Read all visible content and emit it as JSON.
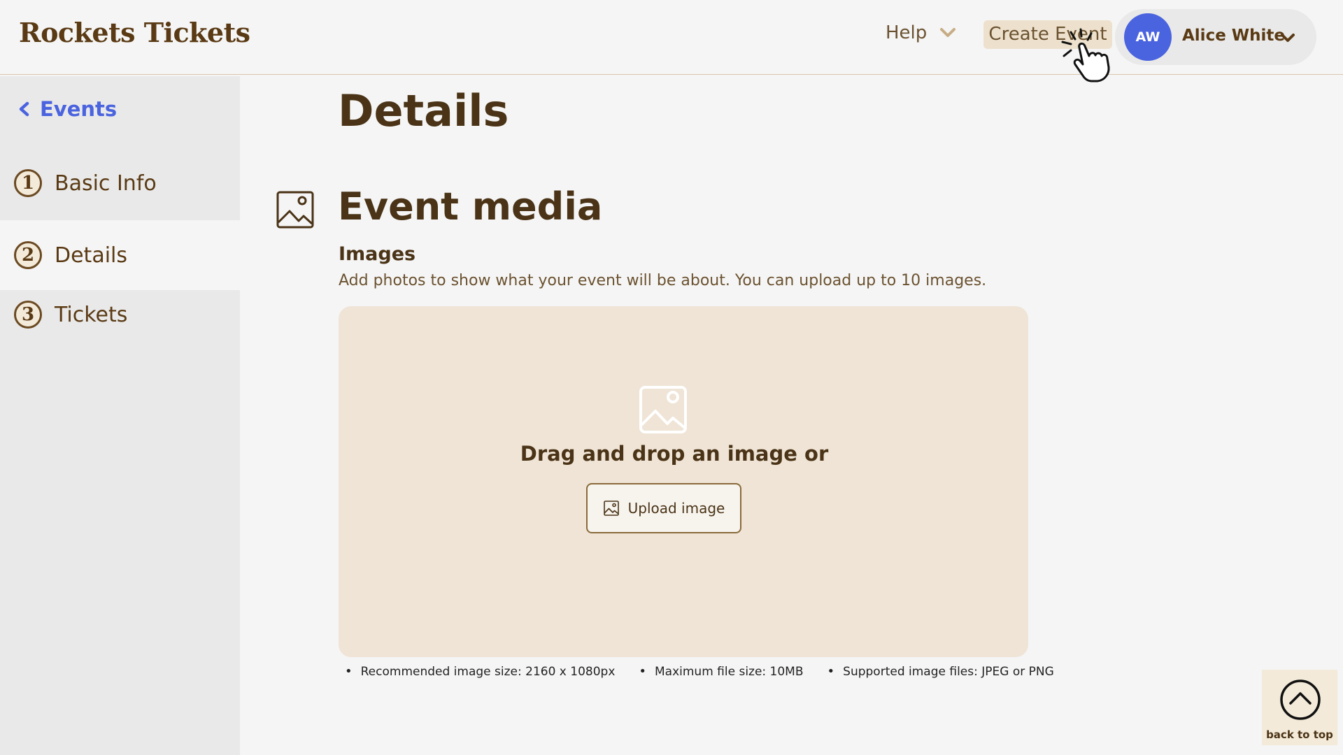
{
  "header": {
    "brand": "Rockets Tickets",
    "help_label": "Help",
    "create_event_label": "Create Event",
    "user": {
      "initials": "AW",
      "name": "Alice White"
    }
  },
  "sidebar": {
    "back_label": "Events",
    "steps": [
      {
        "number": "1",
        "label": "Basic Info",
        "active": false
      },
      {
        "number": "2",
        "label": "Details",
        "active": true
      },
      {
        "number": "3",
        "label": "Tickets",
        "active": false
      }
    ]
  },
  "main": {
    "page_title": "Details",
    "section_title": "Event media",
    "images_label": "Images",
    "images_description": "Add photos to show what your event will be about. You can upload up to 10 images.",
    "dropzone_text": "Drag and drop an image or",
    "upload_button_label": "Upload image",
    "hints": [
      "Recommended image size: 2160 x 1080px",
      "Maximum file size: 10MB",
      "Supported image files: JPEG or PNG"
    ]
  },
  "back_to_top_label": "back to top",
  "colors": {
    "accent_blue": "#4a63df",
    "brown_text": "#4a3316",
    "dropzone_bg": "#efe4d6",
    "create_event_bg": "#ede1cd"
  }
}
